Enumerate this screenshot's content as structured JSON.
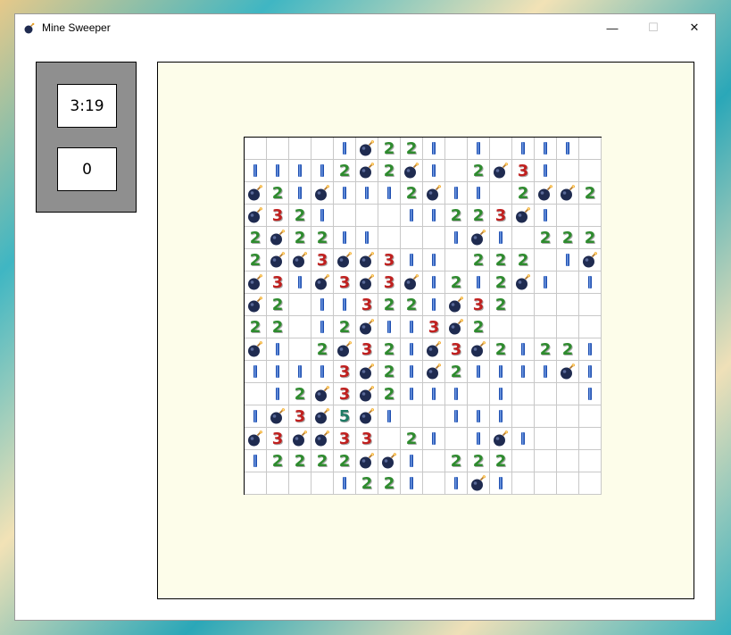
{
  "window": {
    "title": "Mine Sweeper",
    "minimize": "—",
    "maximize": "☐",
    "close": "✕",
    "app_icon": "bomb-icon"
  },
  "status": {
    "timer": "3:19",
    "mines_flagged": "0"
  },
  "colors": {
    "one": "#1f4fb0",
    "two": "#2e8b2e",
    "three": "#c0201f",
    "five": "#1e7a64",
    "bomb": "#1f2b50"
  },
  "board": {
    "rows": 16,
    "cols": 16,
    "cells": [
      "    1B221 1 111 ",
      "11112B2B1 2B31 ",
      "B21B1112B11 2BB21",
      "B321   11223B1",
      "2B2211   1B1 222",
      "2BB3BB311 222 1B1",
      "B31B3B3B1212B1 111",
      "B2 113221B32   ",
      "22 12B113B2   ",
      "B1 2B321B3B21221",
      "11113B21B21111B1",
      " 12B3B2111 1   1221",
      "1B3B5B1  111    ",
      "B3BB33 21 1B1    ",
      "12222BB1 222    ",
      "    1221 1B1    "
    ]
  }
}
